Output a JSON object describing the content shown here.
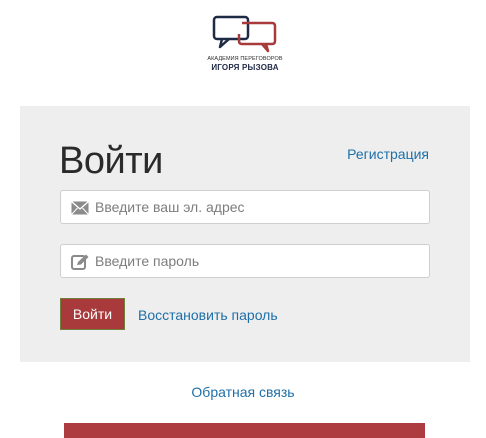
{
  "logo": {
    "line1": "АКАДЕМИЯ ПЕРЕГОВОРОВ",
    "line2": "ИГОРЯ РЫЗОВА",
    "colors": {
      "navy": "#1f2a44",
      "red": "#a83a3c"
    }
  },
  "form": {
    "title": "Войти",
    "register_label": "Регистрация",
    "email": {
      "placeholder": "Введите ваш эл. адрес",
      "value": "",
      "icon": "envelope-icon"
    },
    "password": {
      "placeholder": "Введите пароль",
      "value": "",
      "icon": "pencil-edit-icon"
    },
    "submit_label": "Войти",
    "restore_label": "Восстановить пароль"
  },
  "footer": {
    "feedback_label": "Обратная связь"
  },
  "colors": {
    "accent": "#a83a3c",
    "link": "#1e6fa8",
    "panel_bg": "#eeeeee"
  }
}
